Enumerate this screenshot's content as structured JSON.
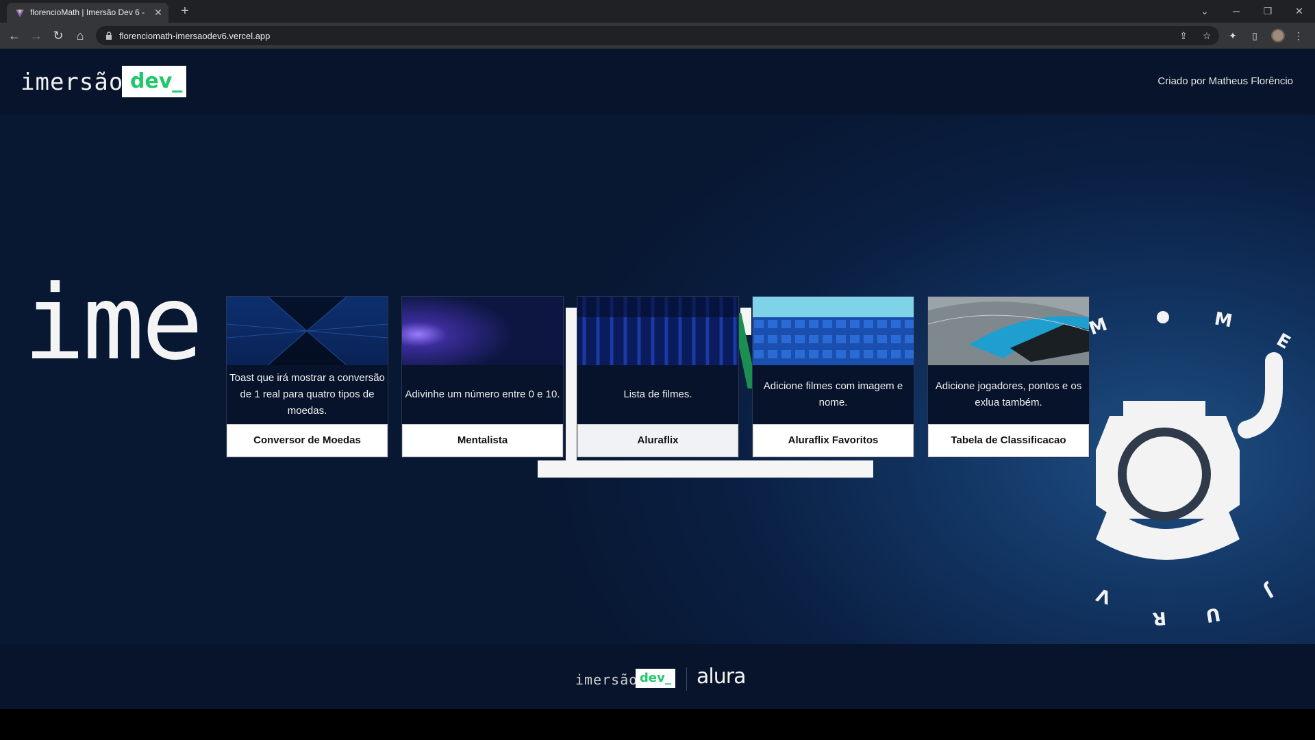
{
  "browser": {
    "tab_title": "florencioMath | Imersão Dev 6 - ",
    "url": "florenciomath-imersaodev6.vercel.app"
  },
  "header": {
    "logo_text": "imersão",
    "logo_badge": "dev_",
    "credit": "Criado por Matheus Florêncio"
  },
  "hero": {
    "big_text": "ime"
  },
  "cards": [
    {
      "description": "Toast que irá mostrar a conversão de 1 real para quatro tipos de moedas.",
      "button": "Conversor de Moedas"
    },
    {
      "description": "Adivinhe um número entre 0 e 10.",
      "button": "Mentalista"
    },
    {
      "description": "Lista de filmes.",
      "button": "Aluraflix"
    },
    {
      "description": "Adicione filmes com imagem e nome.",
      "button": "Aluraflix Favoritos"
    },
    {
      "description": "Adicione jogadores, pontos e os exlua também.",
      "button": "Tabela de Classificacao"
    }
  ],
  "footer": {
    "logo_text": "imersão",
    "logo_badge": "dev_",
    "partner": "alura"
  },
  "colors": {
    "accent_green": "#1ec96b",
    "page_bg": "#0a1a33"
  }
}
